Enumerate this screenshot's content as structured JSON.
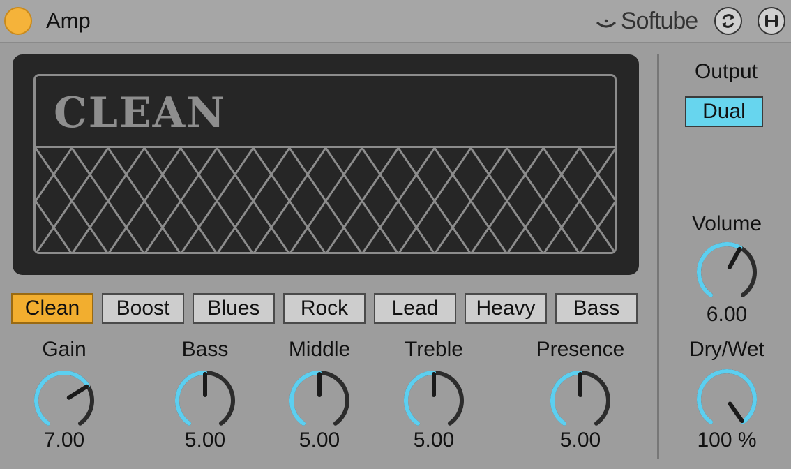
{
  "header": {
    "title": "Amp",
    "brand": "Softube"
  },
  "display": {
    "amp_name": "CLEAN"
  },
  "presets": [
    {
      "label": "Clean",
      "active": true
    },
    {
      "label": "Boost",
      "active": false
    },
    {
      "label": "Blues",
      "active": false
    },
    {
      "label": "Rock",
      "active": false
    },
    {
      "label": "Lead",
      "active": false
    },
    {
      "label": "Heavy",
      "active": false
    },
    {
      "label": "Bass",
      "active": false
    }
  ],
  "knobs": [
    {
      "id": "gain",
      "label": "Gain",
      "value": "7.00",
      "level": 0.7
    },
    {
      "id": "bass",
      "label": "Bass",
      "value": "5.00",
      "level": 0.5
    },
    {
      "id": "middle",
      "label": "Middle",
      "value": "5.00",
      "level": 0.5
    },
    {
      "id": "treble",
      "label": "Treble",
      "value": "5.00",
      "level": 0.5
    },
    {
      "id": "presence",
      "label": "Presence",
      "value": "5.00",
      "level": 0.5
    }
  ],
  "output": {
    "label": "Output",
    "mode": "Dual"
  },
  "volume": {
    "label": "Volume",
    "value": "6.00",
    "level": 0.6
  },
  "drywet": {
    "label": "Dry/Wet",
    "value": "100 %",
    "level": 1.0
  },
  "colors": {
    "accent": "#5ccff0",
    "active_preset": "#f2ae2f",
    "power": "#f5b33a",
    "track": "#2c2c2c"
  },
  "icons": {
    "power": "power-icon",
    "brand": "softube-logo-icon",
    "hot_swap": "hot-swap-icon",
    "save": "save-icon"
  }
}
